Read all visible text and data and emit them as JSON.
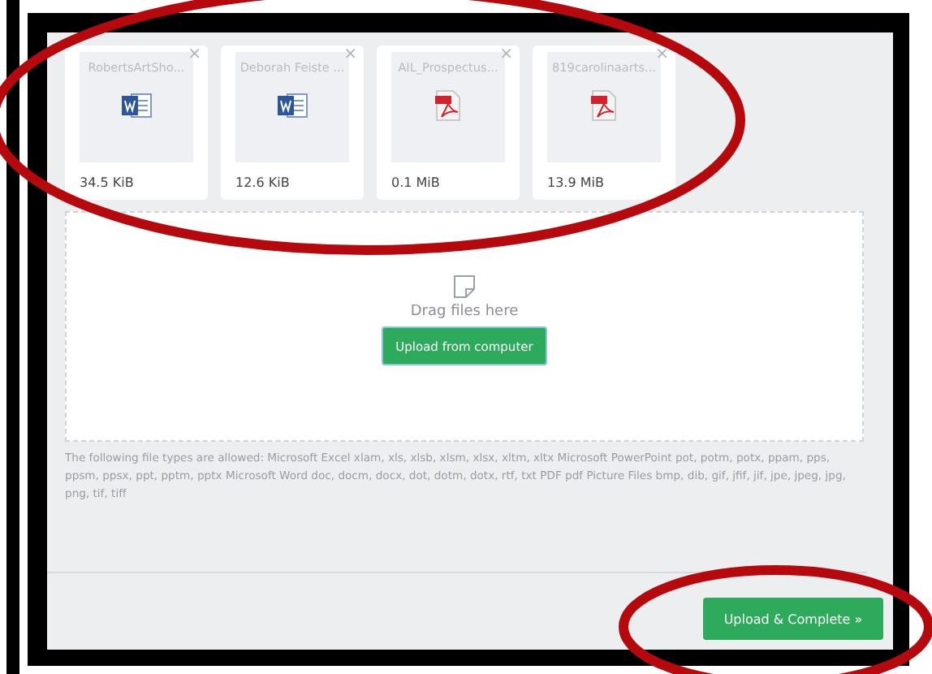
{
  "files": [
    {
      "name": "RobertsArtSho...",
      "kind": "word",
      "size": "34.5 KiB"
    },
    {
      "name": "Deborah Feiste ...",
      "kind": "word",
      "size": "12.6 KiB"
    },
    {
      "name": "AIL_Prospectus...",
      "kind": "pdf",
      "size": "0.1 MiB"
    },
    {
      "name": "819carolinaarts...",
      "kind": "pdf",
      "size": "13.9 MiB"
    }
  ],
  "remove_symbol": "×",
  "dropzone": {
    "hint": "Drag files here",
    "button": "Upload from computer"
  },
  "allowed_types": "The following file types are allowed: Microsoft Excel xlam, xls, xlsb, xlsm, xlsx, xltm, xltx Microsoft PowerPoint pot, potm, potx, ppam, pps, ppsm, ppsx, ppt, pptm, pptx Microsoft Word doc, docm, docx, dot, dotm, dotx, rtf, txt PDF pdf Picture Files bmp, dib, gif, jfif, jif, jpe, jpeg, jpg, png, tif, tiff",
  "submit_button": "Upload & Complete »"
}
